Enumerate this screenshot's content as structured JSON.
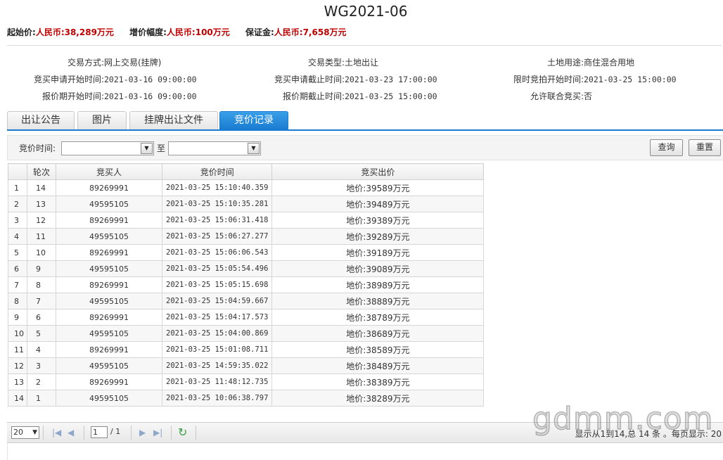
{
  "title": "WG2021-06",
  "price_bar": {
    "start_label": "起始价:",
    "start_value": "人民币:38,289万元",
    "increment_label": "增价幅度:",
    "increment_value": "人民币:100万元",
    "deposit_label": "保证金:",
    "deposit_value": "人民币:7,658万元"
  },
  "info": {
    "trade_method_label": "交易方式:",
    "trade_method": "网上交易(挂牌)",
    "trade_type_label": "交易类型:",
    "trade_type": "土地出让",
    "land_use_label": "土地用途:",
    "land_use": "商住混合用地",
    "apply_start_label": "竞买申请开始时间:",
    "apply_start": "2021-03-16 09:00:00",
    "apply_end_label": "竞买申请截止时间:",
    "apply_end": "2021-03-23 17:00:00",
    "timed_start_label": "限时竞拍开始时间:",
    "timed_start": "2021-03-25 15:00:00",
    "quote_start_label": "报价期开始时间:",
    "quote_start": "2021-03-16 09:00:00",
    "quote_end_label": "报价期截止时间:",
    "quote_end": "2021-03-25 15:00:00",
    "joint_bid_label": "允许联合竞买:",
    "joint_bid": "否"
  },
  "tabs": [
    "出让公告",
    "图片",
    "挂牌出让文件",
    "竞价记录"
  ],
  "active_tab": 3,
  "filter": {
    "label": "竞价时间:",
    "to": "至",
    "query_button": "查询",
    "reset_button": "重置"
  },
  "table": {
    "headers": [
      "",
      "轮次",
      "竞买人",
      "竞价时间",
      "竞买出价"
    ],
    "rows": [
      [
        "1",
        "14",
        "89269991",
        "2021-03-25 15:10:40.359",
        "地价:39589万元"
      ],
      [
        "2",
        "13",
        "49595105",
        "2021-03-25 15:10:35.281",
        "地价:39489万元"
      ],
      [
        "3",
        "12",
        "89269991",
        "2021-03-25 15:06:31.418",
        "地价:39389万元"
      ],
      [
        "4",
        "11",
        "49595105",
        "2021-03-25 15:06:27.277",
        "地价:39289万元"
      ],
      [
        "5",
        "10",
        "89269991",
        "2021-03-25 15:06:06.543",
        "地价:39189万元"
      ],
      [
        "6",
        "9",
        "49595105",
        "2021-03-25 15:05:54.496",
        "地价:39089万元"
      ],
      [
        "7",
        "8",
        "89269991",
        "2021-03-25 15:05:15.698",
        "地价:38989万元"
      ],
      [
        "8",
        "7",
        "49595105",
        "2021-03-25 15:04:59.667",
        "地价:38889万元"
      ],
      [
        "9",
        "6",
        "89269991",
        "2021-03-25 15:04:17.573",
        "地价:38789万元"
      ],
      [
        "10",
        "5",
        "49595105",
        "2021-03-25 15:04:00.869",
        "地价:38689万元"
      ],
      [
        "11",
        "4",
        "89269991",
        "2021-03-25 15:01:08.711",
        "地价:38589万元"
      ],
      [
        "12",
        "3",
        "49595105",
        "2021-03-25 14:59:35.022",
        "地价:38489万元"
      ],
      [
        "13",
        "2",
        "89269991",
        "2021-03-25 11:48:12.735",
        "地价:38389万元"
      ],
      [
        "14",
        "1",
        "49595105",
        "2021-03-25 10:06:38.797",
        "地价:38289万元"
      ]
    ]
  },
  "pager": {
    "page_size": "20",
    "page": "1",
    "of_pages": "/ 1",
    "summary": "显示从1到14,总 14 条 。每页显示: 20"
  },
  "watermark": "gdmm.com"
}
